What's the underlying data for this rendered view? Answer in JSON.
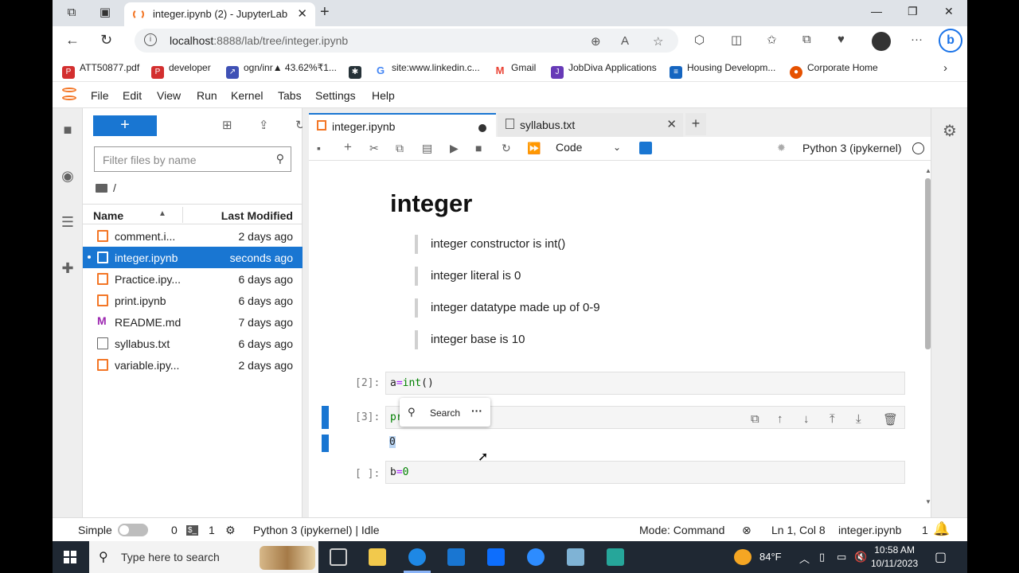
{
  "browser": {
    "tab_title": "integer.ipynb (2) - JupyterLab",
    "url_host": "localhost",
    "url_rest": ":8888/lab/tree/integer.ipynb",
    "bookmarks": [
      {
        "label": "ATT50877.pdf",
        "color": "#d32f2f"
      },
      {
        "label": "developer",
        "color": "#d32f2f"
      },
      {
        "label": "ogn/inr▲ 43.62%₹1...",
        "color": "#3f51b5"
      },
      {
        "label": "site:www.linkedin.c...",
        "color": "#4285f4"
      },
      {
        "label": "Gmail",
        "color": "#ea4335"
      },
      {
        "label": "JobDiva Applications",
        "color": "#673ab7"
      },
      {
        "label": "Housing Developm...",
        "color": "#1565c0"
      },
      {
        "label": "Corporate Home",
        "color": "#e65100"
      }
    ]
  },
  "menu": [
    "File",
    "Edit",
    "View",
    "Run",
    "Kernel",
    "Tabs",
    "Settings",
    "Help"
  ],
  "filebrowser": {
    "new_label": "+",
    "filter_placeholder": "Filter files by name",
    "path": "/",
    "col_name": "Name",
    "col_modified": "Last Modified",
    "files": [
      {
        "name": "comment.i...",
        "modified": "2 days ago",
        "type": "notebook"
      },
      {
        "name": "integer.ipynb",
        "modified": "seconds ago",
        "type": "notebook",
        "selected": true
      },
      {
        "name": "Practice.ipy...",
        "modified": "6 days ago",
        "type": "notebook"
      },
      {
        "name": "print.ipynb",
        "modified": "6 days ago",
        "type": "notebook"
      },
      {
        "name": "README.md",
        "modified": "7 days ago",
        "type": "markdown"
      },
      {
        "name": "syllabus.txt",
        "modified": "6 days ago",
        "type": "text"
      },
      {
        "name": "variable.ipy...",
        "modified": "2 days ago",
        "type": "notebook"
      }
    ]
  },
  "doctabs": [
    {
      "label": "integer.ipynb",
      "active": true
    },
    {
      "label": "syllabus.txt",
      "active": false
    }
  ],
  "nbtoolbar": {
    "cell_type": "Code",
    "kernel": "Python 3 (ipykernel)"
  },
  "notebook": {
    "heading": "integer",
    "quotes": [
      "integer constructor is int()",
      "integer literal is 0",
      "integer datatype made up of 0-9",
      "integer base is 10"
    ],
    "cells": [
      {
        "prompt": "[2]:",
        "code_var": "a",
        "code_op": "=",
        "code_fn": "int",
        "code_rest": "()"
      },
      {
        "prompt": "[3]:",
        "code_partial": "pr",
        "output": "0"
      },
      {
        "prompt": "[ ]:",
        "code_var": "b",
        "code_op": "=",
        "code_num": "0"
      }
    ],
    "popup": {
      "search_label": "Search",
      "more": "···"
    }
  },
  "statusbar": {
    "simple_label": "Simple",
    "terminals": "0",
    "kernels": "1",
    "kernel_status": "Python 3 (ipykernel) | Idle",
    "mode": "Mode: Command",
    "position": "Ln 1, Col 8",
    "filename": "integer.ipynb",
    "notifications": "1"
  },
  "taskbar": {
    "search_placeholder": "Type here to search",
    "weather": "84°F",
    "time": "10:58 AM",
    "date": "10/11/2023"
  }
}
